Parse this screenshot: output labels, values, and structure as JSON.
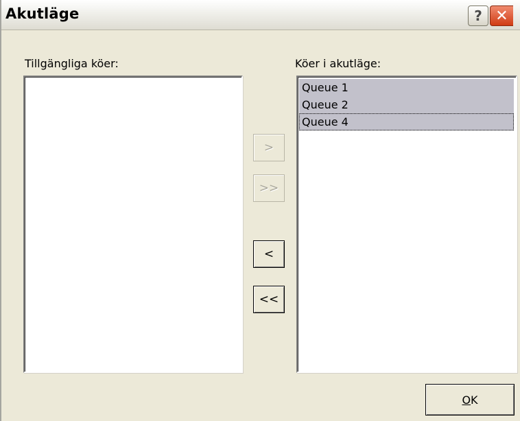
{
  "window": {
    "title": "Akutläge",
    "help_glyph": "?",
    "close_glyph": "✕"
  },
  "available": {
    "label": "Tillgängliga köer:",
    "items": []
  },
  "emergency": {
    "label": "Köer i akutläge:",
    "items": [
      {
        "label": "Queue 1",
        "selected": true
      },
      {
        "label": "Queue 2",
        "selected": true
      },
      {
        "label": "Queue 4",
        "selected": true,
        "focused": true
      }
    ]
  },
  "transfer_buttons": {
    "add_selected": ">",
    "add_all": ">>",
    "remove_selected": "<",
    "remove_all": "<<"
  },
  "footer": {
    "ok_mnemonic": "O",
    "ok_rest": "K"
  },
  "colors": {
    "selection": "#c2c1cb",
    "dialog_bg": "#ece9d8",
    "close_button": "#d03c14"
  }
}
